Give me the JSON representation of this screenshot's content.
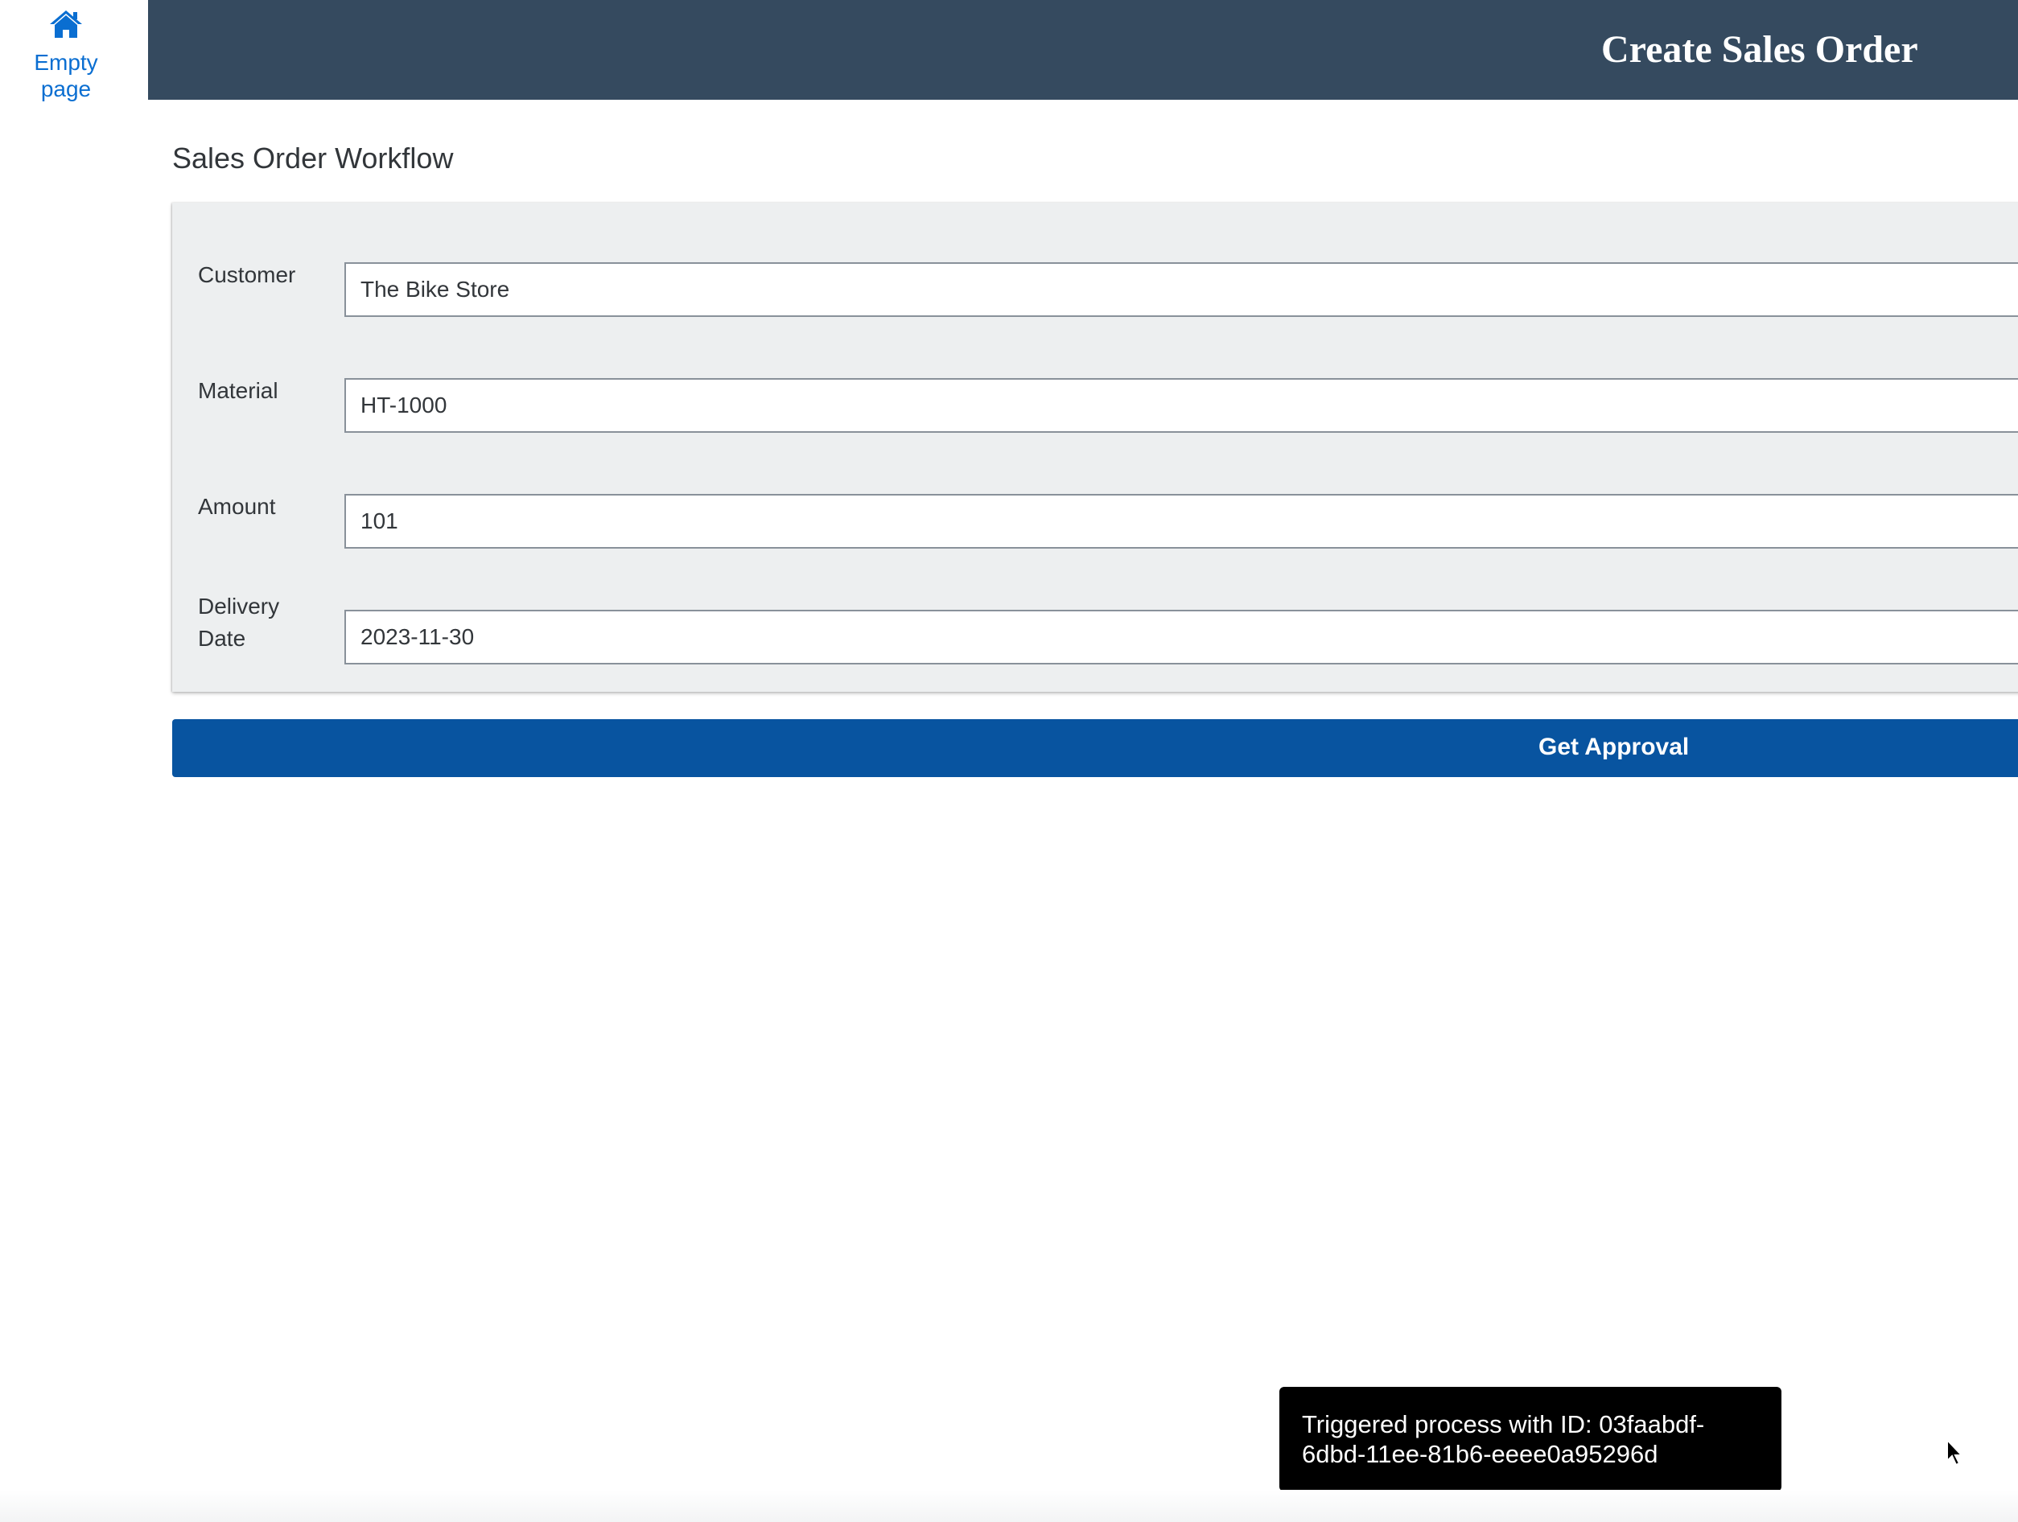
{
  "sidebar": {
    "home_icon": "home-icon",
    "home_label": "Empty page"
  },
  "header": {
    "title": "Create Sales Order"
  },
  "main": {
    "section_title": "Sales Order Workflow",
    "form": {
      "customer_label": "Customer",
      "customer_value": "The Bike Store",
      "material_label": "Material",
      "material_value": "HT-1000",
      "amount_label": "Amount",
      "amount_value": "101",
      "delivery_date_label": "Delivery Date",
      "delivery_date_value": "2023-11-30"
    },
    "approval_button_label": "Get Approval"
  },
  "toast": {
    "message": "Triggered process with ID: 03faabdf-6dbd-11ee-81b6-eeee0a95296d"
  },
  "colors": {
    "header_bg": "#354a5f",
    "accent": "#0a6ed1",
    "button_bg": "#0854a0",
    "panel_bg": "#edeff0",
    "toast_bg": "#000000"
  }
}
